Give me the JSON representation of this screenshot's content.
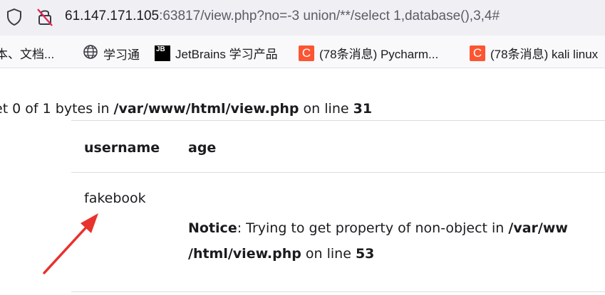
{
  "urlbar": {
    "host": "61.147.171.105",
    "rest": ":63817/view.php?no=-3 union/**/select 1,database(),3,4#",
    "icons": [
      "shield-icon",
      "insecure-lock-icon"
    ]
  },
  "bookmarks": [
    {
      "label": "本、文档...",
      "icon": ""
    },
    {
      "label": "学习通",
      "icon": "globe-icon"
    },
    {
      "label": "JetBrains 学习产品",
      "icon": "jetbrains-icon",
      "icon_text": "JB"
    },
    {
      "label": "(78条消息) Pycharm...",
      "icon": "csdn-icon",
      "icon_text": "C"
    },
    {
      "label": "(78条消息) kali linux",
      "icon": "csdn-icon",
      "icon_text": "C"
    }
  ],
  "warning": {
    "prefix": "et 0 of 1 bytes in ",
    "file": "/var/www/html/view.php",
    "mid": " on line ",
    "line": "31"
  },
  "table": {
    "headers": [
      "username",
      "age"
    ],
    "rows": [
      {
        "username": "fakebook"
      }
    ]
  },
  "notice": {
    "label": "Notice",
    "text": ": Trying to get property of non-object in ",
    "file1": "/var/ww",
    "file2": "/html/view.php",
    "mid": " on line ",
    "line": "53"
  },
  "colors": {
    "annotation_arrow": "#e8322e",
    "csdn": "#fc5531"
  }
}
